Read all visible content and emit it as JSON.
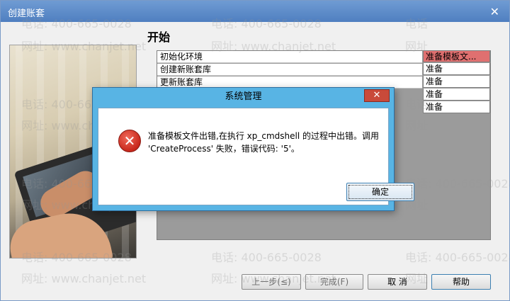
{
  "window": {
    "title": "创建账套",
    "close_glyph": "✕"
  },
  "heading": "开始",
  "steps": [
    {
      "label": "初始化环境",
      "status": "准备模板文..."
    },
    {
      "label": "创建新账套库",
      "status": "准备"
    },
    {
      "label": "更新账套库",
      "status": "准备"
    },
    {
      "label": "",
      "status": "准备"
    },
    {
      "label": "",
      "status": "准备"
    }
  ],
  "buttons": {
    "prev": "上一步(≤)",
    "finish": "完成(F)",
    "cancel": "取 消",
    "help": "帮助"
  },
  "dialog": {
    "title": "系统管理",
    "close_glyph": "✕",
    "message_line1": "准备模板文件出错,在执行 xp_cmdshell 的过程中出错。调用",
    "message_line2": "'CreateProcess' 失败，错误代码: '5'。",
    "ok": "确定",
    "icon": "error-icon"
  },
  "watermark": {
    "phone": "电话: 400-665-0028",
    "site": "网址: www.chanjet.net",
    "phone_short": "电话",
    "site_short": "网址",
    "phone_tail": "400-665-0028"
  },
  "colors": {
    "titlebar": "#5a8bc9",
    "active_status": "#e07070",
    "dialog_frame": "#58b4e4",
    "close_red": "#c94a3a"
  }
}
